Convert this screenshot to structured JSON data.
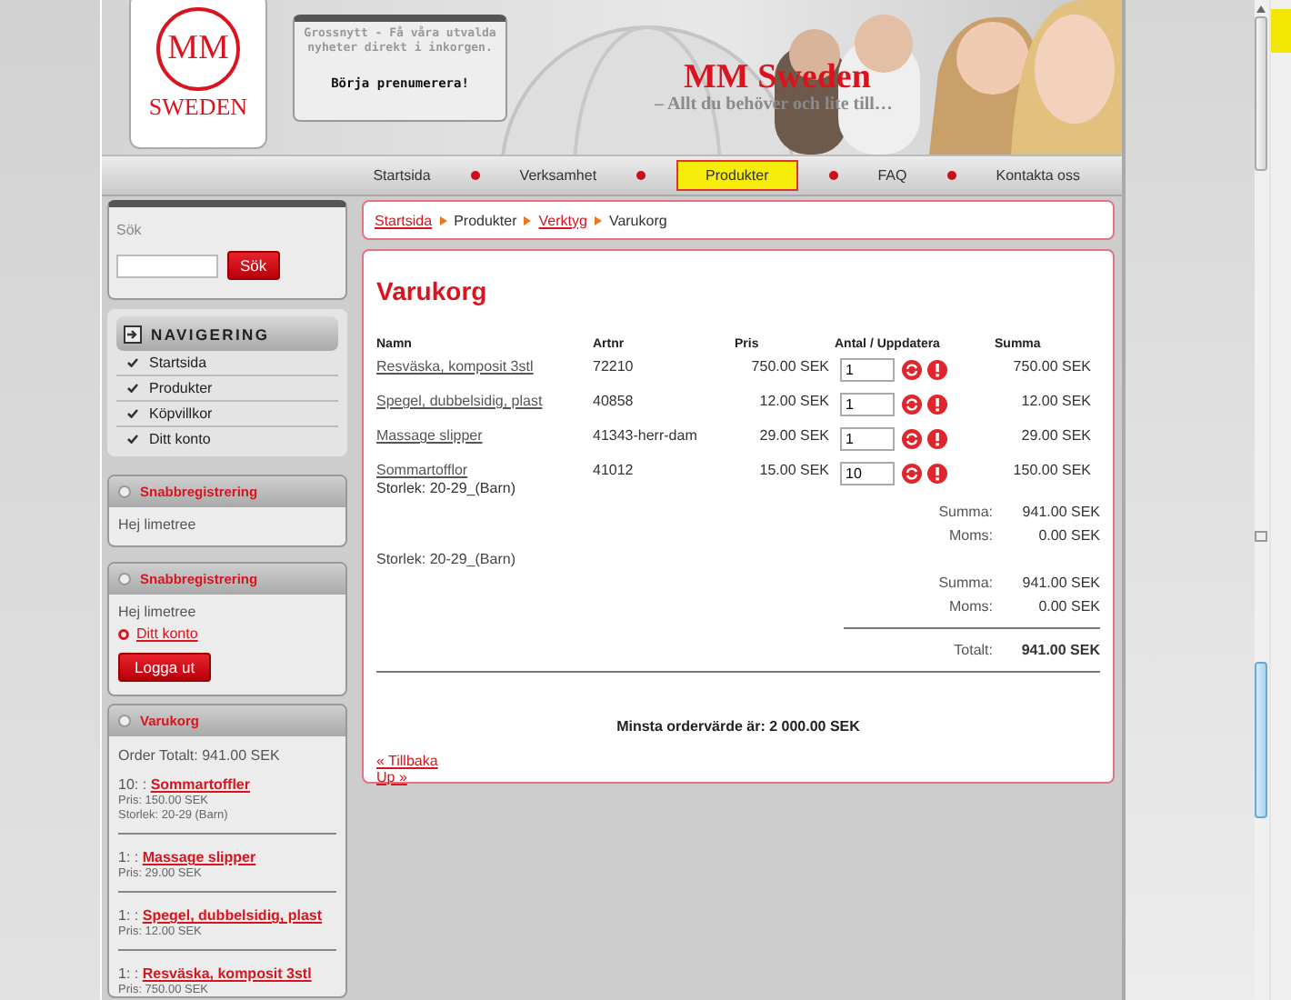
{
  "header": {
    "logo": {
      "monogram": "MM",
      "name": "SWEDEN"
    },
    "newsletter": {
      "text": "Grossnytt - Få våra utvalda nyheter direkt i inkorgen.",
      "link": "Börja prenumerera!"
    },
    "site_title": "MM Sweden",
    "tagline": "– Allt du behöver och lite till…"
  },
  "nav": [
    {
      "label": "Startsida",
      "selected": false
    },
    {
      "label": "Verksamhet",
      "selected": false
    },
    {
      "label": "Produkter",
      "selected": true
    },
    {
      "label": "FAQ",
      "selected": false
    },
    {
      "label": "Kontakta oss",
      "selected": false
    }
  ],
  "sidebar": {
    "search": {
      "label": "Sök",
      "button": "Sök"
    },
    "navigation": {
      "title": "NAVIGERING",
      "items": [
        "Startsida",
        "Produkter",
        "Köpvillkor",
        "Ditt konto"
      ]
    },
    "panels": [
      {
        "title": "Snabbregistrering",
        "greeting": "Hej limetree"
      },
      {
        "title": "Snabbregistrering",
        "greeting": "Hej limetree",
        "link": "Ditt konto",
        "button": "Logga ut"
      }
    ],
    "cart": {
      "title": "Varukorg",
      "total": "Order Totalt: 941.00 SEK",
      "items": [
        {
          "qty": "10: :",
          "name": "Sommartoffler",
          "lines": [
            "Pris: 150.00 SEK",
            "Storlek: 20-29 (Barn)"
          ]
        },
        {
          "qty": "1: :",
          "name": "Massage slipper",
          "lines": [
            "Pris: 29.00 SEK"
          ]
        },
        {
          "qty": "1: :",
          "name": "Spegel, dubbelsidig, plast",
          "lines": [
            "Pris: 12.00 SEK"
          ]
        },
        {
          "qty": "1: :",
          "name": "Resväska, komposit 3stl",
          "lines": [
            "Pris: 750.00 SEK"
          ]
        }
      ]
    }
  },
  "breadcrumb": [
    {
      "label": "Startsida",
      "kind": "link"
    },
    {
      "label": "Produkter",
      "kind": "text"
    },
    {
      "label": "Verktyg",
      "kind": "link"
    },
    {
      "label": "Varukorg",
      "kind": "text"
    }
  ],
  "main": {
    "title": "Varukorg",
    "columns": [
      "Namn",
      "Artnr",
      "Pris",
      "Antal / Uppdatera",
      "Summa"
    ],
    "rows": [
      {
        "name": "Resväska, komposit 3stl",
        "artnr": "72210",
        "price": "750.00 SEK",
        "qty": "1",
        "sum": "750.00 SEK"
      },
      {
        "name": "Spegel, dubbelsidig, plast",
        "artnr": "40858",
        "price": "12.00 SEK",
        "qty": "1",
        "sum": "12.00 SEK"
      },
      {
        "name": "Massage slipper",
        "artnr": "41343-herr-dam",
        "price": "29.00 SEK",
        "qty": "1",
        "sum": "29.00 SEK"
      },
      {
        "name": "Sommartofflor",
        "size": "Storlek: 20-29_(Barn)",
        "artnr": "41012",
        "price": "15.00 SEK",
        "qty": "10",
        "sum": "150.00 SEK"
      }
    ],
    "summary": [
      {
        "label": "Summa:",
        "value": "941.00 SEK"
      },
      {
        "label": "Moms:",
        "value": "0.00 SEK"
      }
    ],
    "ghost_text": "Storlek: 20-29_(Barn)",
    "summary_repeat": [
      {
        "label": "Summa:",
        "value": "941.00 SEK"
      },
      {
        "label": "Moms:",
        "value": "0.00 SEK"
      }
    ],
    "total": {
      "label": "Totalt:",
      "value": "941.00 SEK"
    },
    "minimum": "Minsta ordervärde är: 2 000.00 SEK",
    "links": [
      "« Tillbaka",
      "Up »"
    ]
  }
}
